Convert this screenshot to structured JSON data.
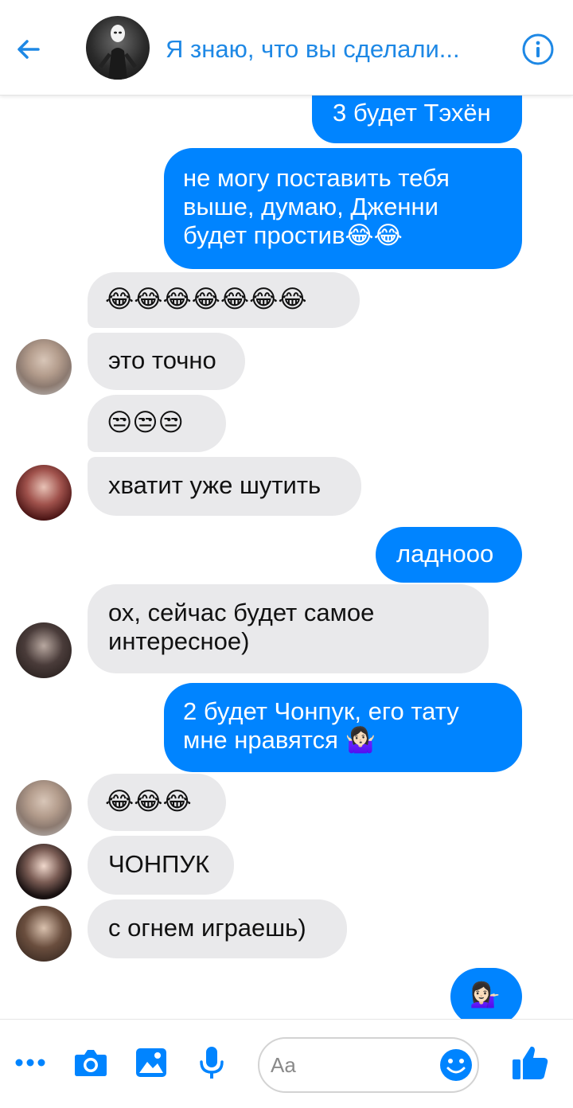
{
  "header": {
    "title": "Я знаю, что вы сделали..."
  },
  "messages": [
    {
      "side": "out",
      "text": "3 будет Тэхён"
    },
    {
      "side": "out",
      "text": "не могу поставить тебя выше, думаю, Дженни будет простив😂😂"
    },
    {
      "side": "in",
      "text": "😂😂😂😂😂😂😂"
    },
    {
      "side": "in",
      "text": "это точно"
    },
    {
      "side": "in",
      "text": "😒😒😒"
    },
    {
      "side": "in",
      "text": "хватит уже шутить"
    },
    {
      "side": "out",
      "text": "ладнооо"
    },
    {
      "side": "in",
      "text": "ох, сейчас будет самое интересное)"
    },
    {
      "side": "out",
      "text": "2 будет Чонпук, его тату мне нравятся 🤷🏻‍♀️"
    },
    {
      "side": "in",
      "text": "😂😂😂"
    },
    {
      "side": "in",
      "text": "ЧОНПУК"
    },
    {
      "side": "in",
      "text": "с огнем играешь)"
    },
    {
      "side": "out",
      "text": "💁🏻‍♀️"
    }
  ],
  "composer": {
    "placeholder": "Aa"
  },
  "colors": {
    "accent": "#0084ff",
    "header_text": "#1e88e5",
    "incoming_bubble": "#e9e9eb"
  },
  "icons": [
    "back-arrow-icon",
    "info-icon",
    "more-icon",
    "camera-icon",
    "image-icon",
    "microphone-icon",
    "emoji-icon",
    "like-icon"
  ]
}
